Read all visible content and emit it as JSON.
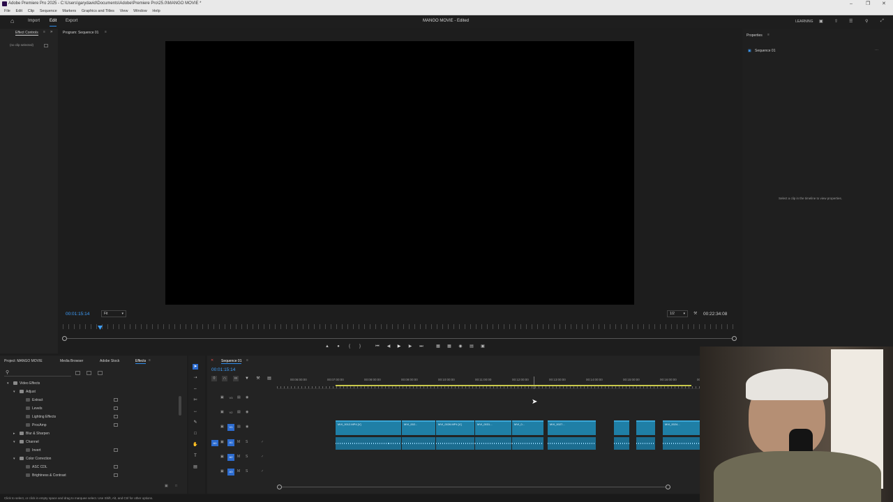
{
  "titlebar": {
    "title": "Adobe Premiere Pro 2025 - C:\\Users\\garydavid\\Documents\\Adobe\\Premiere Pro\\25.0\\MANGO MOVIE *"
  },
  "menu": [
    "File",
    "Edit",
    "Clip",
    "Sequence",
    "Markers",
    "Graphics and Titles",
    "View",
    "Window",
    "Help"
  ],
  "topbar": {
    "import": "Import",
    "edit": "Edit",
    "export": "Export",
    "project_title": "MANGO MOVIE - Edited",
    "learning": "LEARNING"
  },
  "effect_controls": {
    "tab": "Effect Controls",
    "no_clip": "(no clip selected)"
  },
  "program": {
    "tab": "Program: Sequence 01",
    "timecode": "00:01:15:14",
    "fit": "Fit",
    "resolution": "1/2",
    "duration": "00:22:34:08"
  },
  "properties": {
    "tab": "Properties",
    "sequence": "Sequence 01",
    "hint": "Select a clip in the timeline to view properties."
  },
  "project_panel": {
    "tabs": [
      "Project: MANGO MOVIE",
      "Media Browser",
      "Adobe Stock",
      "Effects"
    ],
    "tree": [
      {
        "label": "Video Effects",
        "level": 0,
        "open": true
      },
      {
        "label": "Adjust",
        "level": 1,
        "open": true
      },
      {
        "label": "Extract",
        "level": 2
      },
      {
        "label": "Levels",
        "level": 2
      },
      {
        "label": "Lighting Effects",
        "level": 2
      },
      {
        "label": "ProcAmp",
        "level": 2
      },
      {
        "label": "Blur & Sharpen",
        "level": 1,
        "open": false
      },
      {
        "label": "Channel",
        "level": 1,
        "open": true
      },
      {
        "label": "Invert",
        "level": 2
      },
      {
        "label": "Color Correction",
        "level": 1,
        "open": true
      },
      {
        "label": "ASC CDL",
        "level": 2
      },
      {
        "label": "Brightness & Contrast",
        "level": 2
      }
    ]
  },
  "timeline": {
    "tab": "Sequence 01",
    "timecode": "00:01:15:14",
    "ruler": [
      "00:06:00:00",
      "00:07:00:00",
      "00:08:00:00",
      "00:09:00:00",
      "00:10:00:00",
      "00:11:00:00",
      "00:12:00:00",
      "00:13:00:00",
      "00:14:00:00",
      "00:15:00:00",
      "00:16:00:00",
      "00:0"
    ],
    "video_tracks": [
      "V3",
      "V2",
      "V1"
    ],
    "audio_tracks": [
      "A1",
      "A2",
      "A3"
    ],
    "clips": [
      "MVI_0012.MP4 [V]",
      "MVI_002...",
      "MVI_0026.MP4 [V]",
      "MVI_0031...",
      "MVI_0...",
      "MVI_0027...",
      "MVI_0024..."
    ]
  },
  "statusbar": {
    "text": "Click to select, or click in empty space and drag to marquee select. Use Shift, Alt, and Ctrl for other options."
  }
}
